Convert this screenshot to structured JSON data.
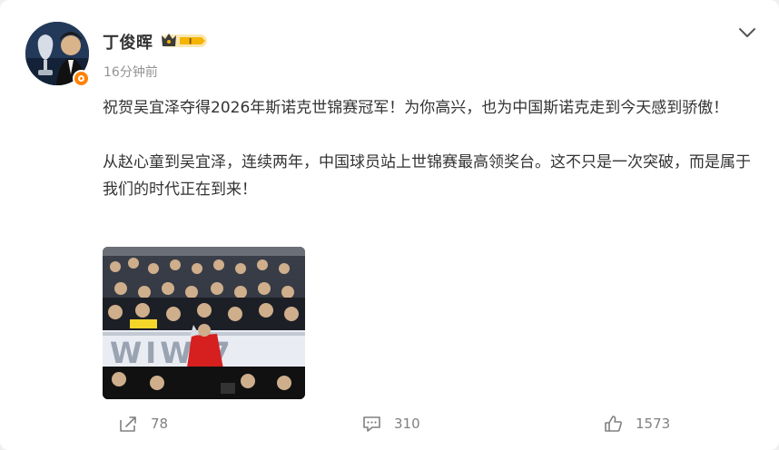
{
  "post": {
    "author": "丁俊晖",
    "time": "16分钟前",
    "paragraphs": [
      "祝贺吴宜泽夺得2026年斯诺克世锦赛冠军！为你高兴，也为中国斯诺克走到今天感到骄傲！",
      "从赵心童到吴宜泽，连续两年，中国球员站上世锦赛最高领奖台。这不只是一次突破，而是属于我们的时代正在到来！"
    ],
    "image_icons": [
      "snooker-trophy-photo"
    ],
    "image_banner_text": "WIWI7"
  },
  "vip": {
    "level": "I"
  },
  "stats": {
    "shares": "78",
    "comments": "310",
    "likes": "1573"
  },
  "icons": {
    "more": "chevron-down-icon",
    "share": "share-icon",
    "comment": "comment-icon",
    "like": "thumbs-up-icon",
    "verified": "verified-badge-icon",
    "vip": "crown-icon"
  },
  "colors": {
    "accent": "#ff8200",
    "text": "#333333",
    "muted": "#939393",
    "vip_gold": "#f5b400"
  }
}
